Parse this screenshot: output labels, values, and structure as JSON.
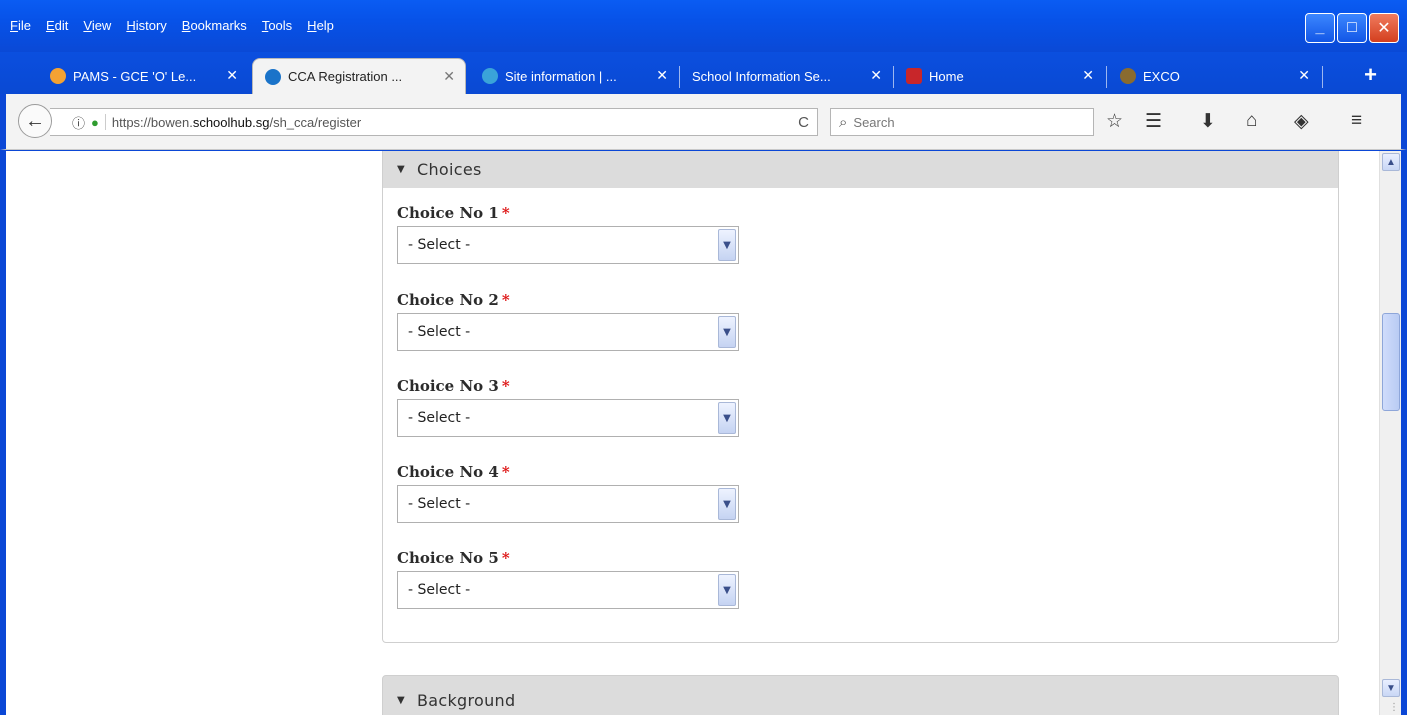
{
  "menu": [
    "File",
    "Edit",
    "View",
    "History",
    "Bookmarks",
    "Tools",
    "Help"
  ],
  "window_controls": {
    "minimize": "_",
    "maximize": "□",
    "close": "✕"
  },
  "tabs": [
    {
      "label": "PAMS - GCE 'O' Le...",
      "close": "✕",
      "icon_color": "#f4a233"
    },
    {
      "label": "CCA Registration ...",
      "close": "✕",
      "icon_color": "#1a73c9"
    },
    {
      "label": "Site information | ...",
      "close": "✕",
      "icon_color": "#3aa3d9"
    },
    {
      "label": "School Information Se...",
      "close": "✕"
    },
    {
      "label": "Home",
      "close": "✕",
      "icon_color": "#c8262a"
    },
    {
      "label": "EXCO",
      "close": "✕",
      "icon_color": "#8a6b2f"
    }
  ],
  "new_tab": "+",
  "nav": {
    "back": "←",
    "info": "ⓘ",
    "lock": "🔒",
    "url_prefix": "https://bowen.",
    "url_domain": "schoolhub.sg",
    "url_path": "/sh_cca/register",
    "reload": "C",
    "search_placeholder": "Search",
    "search_icon": "⌕"
  },
  "toolbar_icons": {
    "bookmark": "☆",
    "library": "☰",
    "download": "⬇",
    "home": "⌂",
    "pocket": "◈",
    "menu": "≡"
  },
  "form": {
    "choices_legend": "Choices",
    "required_mark": "*",
    "choices": [
      {
        "label": "Choice No 1",
        "value": "- Select -"
      },
      {
        "label": "Choice No 2",
        "value": "- Select -"
      },
      {
        "label": "Choice No 3",
        "value": "- Select -"
      },
      {
        "label": "Choice No 4",
        "value": "- Select -"
      },
      {
        "label": "Choice No 5",
        "value": "- Select -"
      }
    ],
    "background_legend": "Background"
  },
  "colors": {
    "window_blue": "#0b47d6",
    "required_red": "#dd1111",
    "legend_bg": "#dcdcdc"
  }
}
